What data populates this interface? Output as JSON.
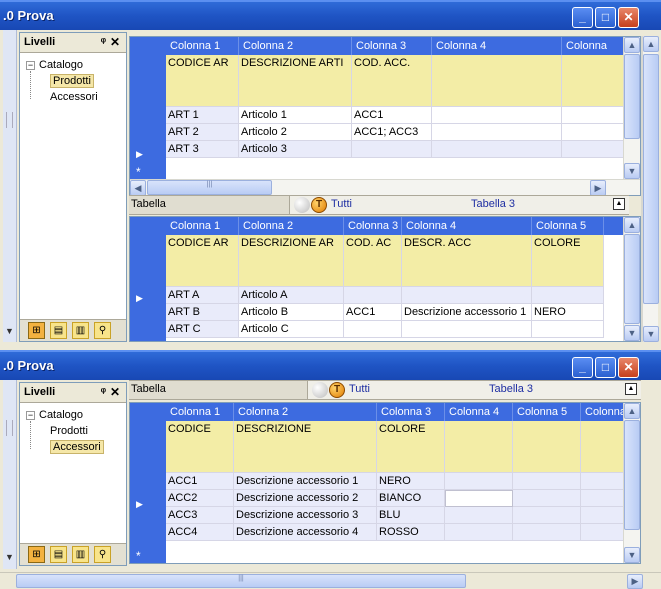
{
  "window1": {
    "title": ".0 Prova",
    "panel_title": "Livelli",
    "tree": {
      "root": "Catalogo",
      "children": [
        "Prodotti",
        "Accessori"
      ],
      "selected": "Prodotti"
    },
    "grid_top": {
      "columns": [
        "Colonna 1",
        "Colonna 2",
        "Colonna 3",
        "Colonna 4",
        "Colonna"
      ],
      "header_row": [
        "CODICE AR",
        "DESCRIZIONE ARTI",
        "COD. ACC."
      ],
      "rows": [
        [
          "ART 1",
          "Articolo 1",
          "ACC1"
        ],
        [
          "ART 2",
          "Articolo 2",
          "ACC1; ACC3"
        ],
        [
          "ART 3",
          "Articolo 3",
          ""
        ]
      ]
    },
    "tab_strip": {
      "name": "Tabella",
      "filter": "Tutti",
      "table": "Tabella 3"
    },
    "grid_bottom": {
      "columns": [
        "Colonna 1",
        "Colonna 2",
        "Colonna 3",
        "Colonna 4",
        "Colonna 5"
      ],
      "header_row": [
        "CODICE AR",
        "DESCRIZIONE AR",
        "COD. AC",
        "DESCR. ACC",
        "COLORE"
      ],
      "rows": [
        [
          "ART A",
          "Articolo A",
          "",
          "",
          ""
        ],
        [
          "ART B",
          "Articolo B",
          "ACC1",
          "Descrizione accessorio 1",
          "NERO"
        ],
        [
          "ART C",
          "Articolo C",
          "",
          "",
          ""
        ]
      ]
    }
  },
  "window2": {
    "title": ".0 Prova",
    "panel_title": "Livelli",
    "tree": {
      "root": "Catalogo",
      "children": [
        "Prodotti",
        "Accessori"
      ],
      "selected": "Accessori"
    },
    "tab_strip": {
      "name": "Tabella",
      "filter": "Tutti",
      "table": "Tabella 3"
    },
    "grid": {
      "columns": [
        "Colonna 1",
        "Colonna 2",
        "Colonna 3",
        "Colonna 4",
        "Colonna 5",
        "Colonna"
      ],
      "header_row": [
        "CODICE",
        "DESCRIZIONE",
        "COLORE"
      ],
      "rows": [
        [
          "ACC1",
          "Descrizione accessorio 1",
          "NERO"
        ],
        [
          "ACC2",
          "Descrizione accessorio 2",
          "BIANCO"
        ],
        [
          "ACC3",
          "Descrizione accessorio 3",
          "BLU"
        ],
        [
          "ACC4",
          "Descrizione accessorio 4",
          "ROSSO"
        ]
      ]
    }
  },
  "icons": {
    "minimize": "minimize-icon",
    "maximize": "maximize-icon",
    "close": "close-icon",
    "pin": "pin-icon"
  }
}
